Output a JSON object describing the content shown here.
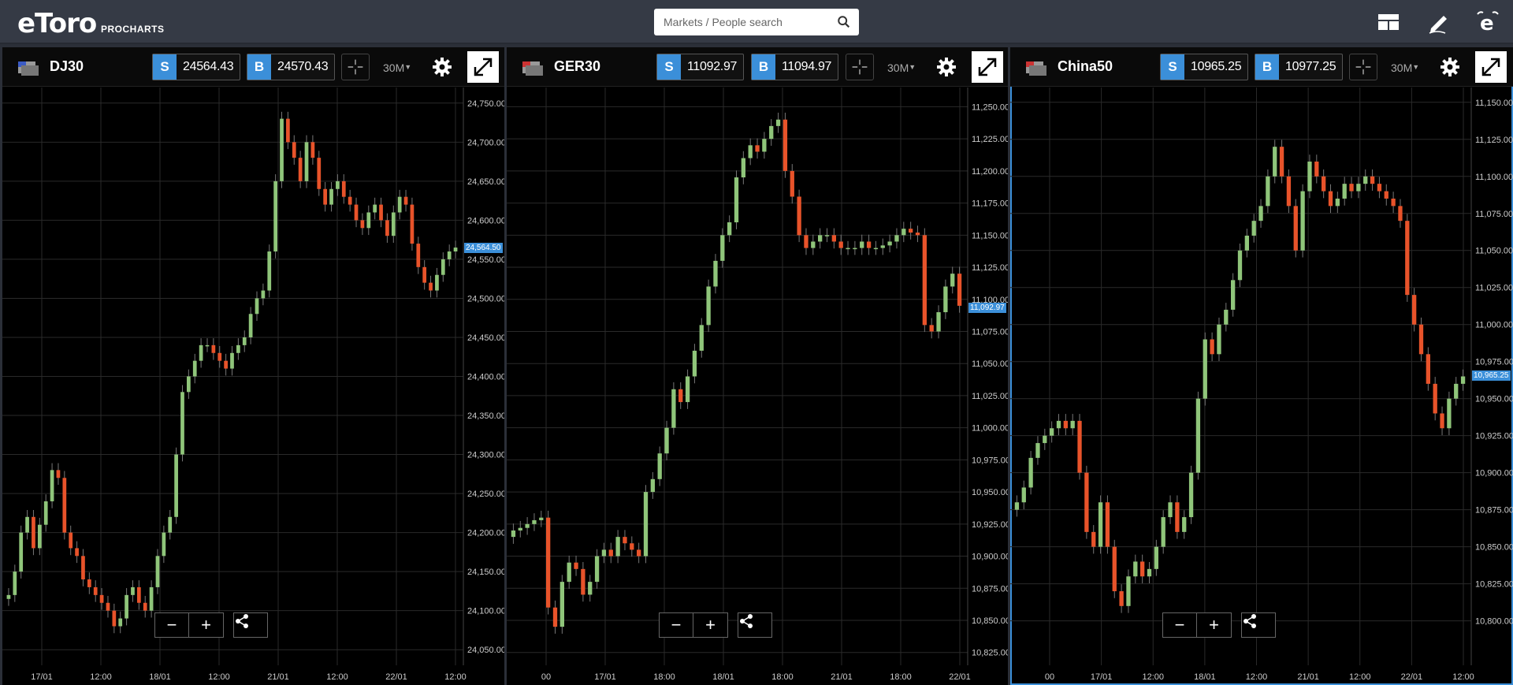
{
  "header": {
    "logo": "eToro",
    "logo_sub": "PROCHARTS",
    "search_placeholder": "Markets / People search"
  },
  "charts": [
    {
      "symbol": "DJ30",
      "sell_label": "S",
      "sell_price": "24564.43",
      "buy_label": "B",
      "buy_price": "24570.43",
      "timeframe": "30M",
      "last_price_label": "24,564.50",
      "y_ticks": [
        "24,750.00",
        "24,700.00",
        "24,650.00",
        "24,600.00",
        "24,550.00",
        "24,500.00",
        "24,450.00",
        "24,400.00",
        "24,350.00",
        "24,300.00",
        "24,250.00",
        "24,200.00",
        "24,150.00",
        "24,100.00",
        "24,050.00"
      ],
      "x_ticks": [
        "17/01",
        "12:00",
        "18/01",
        "12:00",
        "21/01",
        "12:00",
        "22/01",
        "12:00"
      ],
      "active": false
    },
    {
      "symbol": "GER30",
      "sell_label": "S",
      "sell_price": "11092.97",
      "buy_label": "B",
      "buy_price": "11094.97",
      "timeframe": "30M",
      "last_price_label": "11,092.97",
      "y_ticks": [
        "11,250.00",
        "11,225.00",
        "11,200.00",
        "11,175.00",
        "11,150.00",
        "11,125.00",
        "11,100.00",
        "11,075.00",
        "11,050.00",
        "11,025.00",
        "11,000.00",
        "10,975.00",
        "10,950.00",
        "10,925.00",
        "10,900.00",
        "10,875.00",
        "10,850.00",
        "10,825.00"
      ],
      "x_ticks": [
        "00",
        "17/01",
        "18:00",
        "18/01",
        "18:00",
        "21/01",
        "18:00",
        "22/01"
      ],
      "active": false
    },
    {
      "symbol": "China50",
      "sell_label": "S",
      "sell_price": "10965.25",
      "buy_label": "B",
      "buy_price": "10977.25",
      "timeframe": "30M",
      "last_price_label": "10,965.25",
      "y_ticks": [
        "11,150.00",
        "11,125.00",
        "11,100.00",
        "11,075.00",
        "11,050.00",
        "11,025.00",
        "11,000.00",
        "10,975.00",
        "10,950.00",
        "10,925.00",
        "10,900.00",
        "10,875.00",
        "10,850.00",
        "10,825.00",
        "10,800.00"
      ],
      "x_ticks": [
        "00",
        "17/01",
        "12:00",
        "18/01",
        "12:00",
        "21/01",
        "12:00",
        "22/01",
        "12:00"
      ],
      "active": true
    }
  ],
  "controls": {
    "zoom_out": "−",
    "zoom_in": "+"
  },
  "chart_data": [
    {
      "type": "candlestick",
      "title": "DJ30",
      "ylim": [
        24030,
        24770
      ],
      "close": [
        24120,
        24150,
        24200,
        24220,
        24180,
        24210,
        24240,
        24280,
        24270,
        24200,
        24180,
        24170,
        24140,
        24130,
        24120,
        24110,
        24100,
        24080,
        24090,
        24120,
        24130,
        24110,
        24100,
        24130,
        24170,
        24200,
        24220,
        24300,
        24380,
        24400,
        24420,
        24440,
        24440,
        24430,
        24420,
        24410,
        24430,
        24440,
        24450,
        24480,
        24500,
        24510,
        24560,
        24650,
        24730,
        24700,
        24680,
        24650,
        24700,
        24680,
        24640,
        24620,
        24640,
        24650,
        24630,
        24620,
        24600,
        24590,
        24610,
        24620,
        24600,
        24580,
        24610,
        24630,
        24620,
        24570,
        24540,
        24520,
        24510,
        24530,
        24550,
        24560,
        24565
      ],
      "colors": {
        "up": "#8fc57a",
        "down": "#e8532a"
      }
    },
    {
      "type": "candlestick",
      "title": "GER30",
      "ylim": [
        10815,
        11265
      ],
      "close": [
        10920,
        10922,
        10925,
        10928,
        10930,
        10860,
        10845,
        10880,
        10895,
        10890,
        10870,
        10880,
        10900,
        10905,
        10900,
        10915,
        10910,
        10905,
        10900,
        10950,
        10960,
        10980,
        11000,
        11030,
        11020,
        11040,
        11060,
        11080,
        11110,
        11130,
        11150,
        11160,
        11195,
        11210,
        11220,
        11215,
        11225,
        11235,
        11240,
        11200,
        11180,
        11150,
        11140,
        11145,
        11150,
        11150,
        11145,
        11140,
        11140,
        11140,
        11145,
        11140,
        11140,
        11142,
        11145,
        11150,
        11155,
        11152,
        11150,
        11080,
        11075,
        11090,
        11110,
        11120,
        11095
      ],
      "colors": {
        "up": "#8fc57a",
        "down": "#e8532a"
      }
    },
    {
      "type": "candlestick",
      "title": "China50",
      "ylim": [
        10770,
        11160
      ],
      "close": [
        10880,
        10890,
        10910,
        10920,
        10925,
        10930,
        10935,
        10930,
        10935,
        10900,
        10860,
        10850,
        10880,
        10850,
        10820,
        10810,
        10830,
        10840,
        10830,
        10835,
        10850,
        10870,
        10880,
        10860,
        10870,
        10900,
        10950,
        10990,
        10980,
        11000,
        11010,
        11030,
        11050,
        11060,
        11070,
        11080,
        11100,
        11120,
        11100,
        11080,
        11050,
        11090,
        11110,
        11100,
        11090,
        11080,
        11085,
        11095,
        11090,
        11095,
        11100,
        11095,
        11090,
        11085,
        11080,
        11070,
        11020,
        11000,
        10980,
        10960,
        10940,
        10930,
        10950,
        10960,
        10965
      ],
      "colors": {
        "up": "#8fc57a",
        "down": "#e8532a"
      }
    }
  ]
}
